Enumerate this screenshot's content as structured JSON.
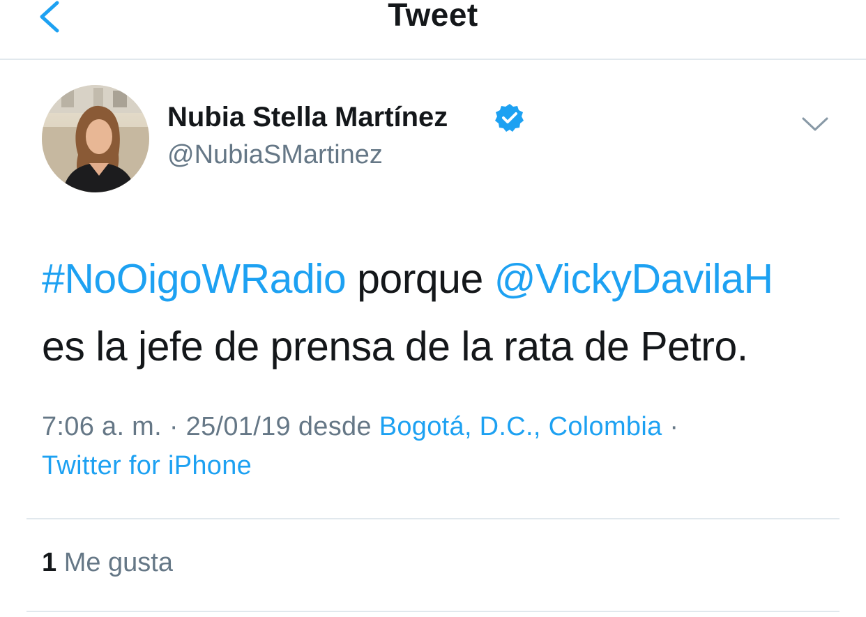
{
  "nav": {
    "title": "Tweet",
    "back_icon": "chevron-left-icon"
  },
  "colors": {
    "link": "#1da1f2",
    "secondary_text": "#657786",
    "primary_text": "#14171a",
    "divider": "#e1e8ed"
  },
  "tweet": {
    "author": {
      "display_name": "Nubia Stella Martínez",
      "handle": "@NubiaSMartinez",
      "verified_icon": "verified-badge-icon"
    },
    "menu_icon": "chevron-down-icon",
    "text": {
      "hashtag": "#NoOigoWRadio",
      "text_1": " porque ",
      "mention": "@VickyDavilaH",
      "text_2": "es la jefe de prensa de la rata de Petro."
    },
    "meta": {
      "time_date": "7:06 a. m. · 25/01/19 desde ",
      "location": "Bogotá, D.C., Colombia",
      "sep": " ·",
      "client": "Twitter for iPhone"
    },
    "likes": {
      "count": "1",
      "label": " Me gusta"
    }
  }
}
